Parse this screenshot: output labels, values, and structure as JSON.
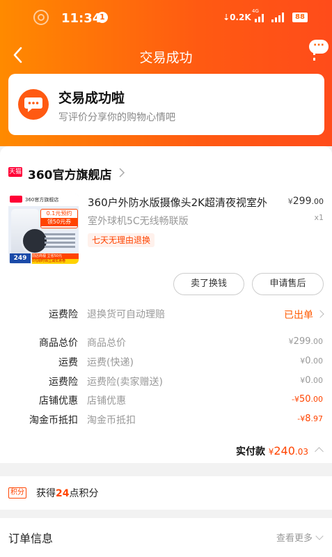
{
  "status_bar": {
    "time": "11:34",
    "notification_count": "1",
    "network_speed": "0.2K",
    "network_type": "4G",
    "battery": "88"
  },
  "nav": {
    "title": "交易成功"
  },
  "success": {
    "title": "交易成功啦",
    "subtitle": "写评价分享你的购物心情吧"
  },
  "shop": {
    "badge": "天猫",
    "name": "360官方旗舰店",
    "product": {
      "title": "360户外防水版摄像头2K超清夜视室外",
      "sku": "室外球机5C无线畅联版",
      "tag": "七天无理由退换",
      "price_currency": "¥",
      "price_int": "299",
      "price_dec": ".00",
      "quantity": "x1",
      "image": {
        "brand_text": "360官方旗舰店",
        "promo_line1": "0.1元预约",
        "promo_line2": "领50元券",
        "price_tag": "249",
        "bottom_text": "前店商视 立省50元",
        "footer_text": "0元限时领立减优惠卷"
      }
    },
    "buttons": {
      "sell": "卖了换钱",
      "after_sale": "申请售后"
    },
    "rows": [
      {
        "label": "运费险",
        "desc": "退换货可自动理赔",
        "value": "已出单"
      },
      {
        "label": "商品总价",
        "desc": "商品总价",
        "cur": "¥",
        "int": "299",
        "dec": ".00"
      },
      {
        "label": "运费",
        "desc": "运费(快递)",
        "cur": "¥",
        "int": "0",
        "dec": ".00"
      },
      {
        "label": "运费险",
        "desc": "运费险(卖家赠送)",
        "cur": "¥",
        "int": "0",
        "dec": ".00"
      },
      {
        "label": "店铺优惠",
        "desc": "店铺优惠",
        "cur": "-¥",
        "int": "50",
        "dec": ".00"
      },
      {
        "label": "淘金币抵扣",
        "desc": "淘金币抵扣",
        "cur": "-¥",
        "int": "8",
        "dec": ".97"
      }
    ],
    "total": {
      "label": "实付款",
      "cur": "¥",
      "int": "240",
      "dec": ".03"
    }
  },
  "points": {
    "tag": "积分",
    "prefix": "获得",
    "count": "24",
    "suffix": "点积分"
  },
  "order": {
    "title": "订单信息",
    "more": "查看更多"
  },
  "colors": {
    "header_start": "#ff8a00",
    "header_end": "#ff4c1a",
    "accent_red": "#ff4400",
    "tmall_red": "#ff0036"
  }
}
